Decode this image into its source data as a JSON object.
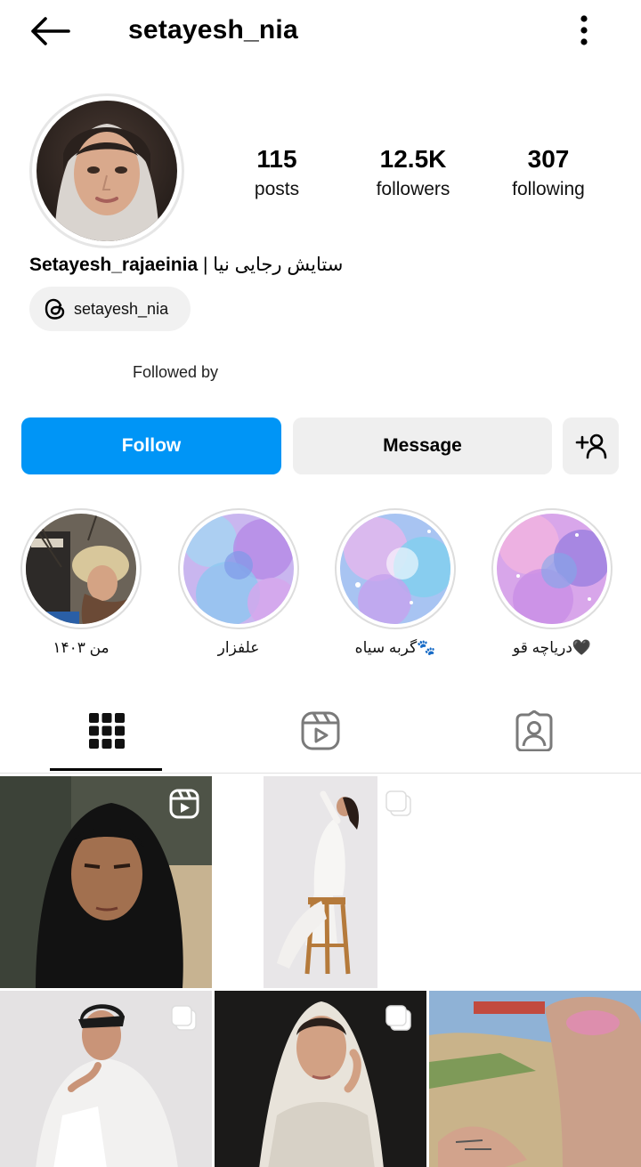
{
  "header": {
    "username": "setayesh_nia"
  },
  "profile": {
    "stats": [
      {
        "count": "115",
        "label": "posts"
      },
      {
        "count": "12.5K",
        "label": "followers"
      },
      {
        "count": "307",
        "label": "following"
      }
    ],
    "fullname_latin": "Setayesh_rajaeinia",
    "fullname_separator": " | ",
    "fullname_persian": "ستایش رجایی نیا",
    "threads_handle": "setayesh_nia",
    "followed_by_label": "Followed by"
  },
  "actions": {
    "follow_label": "Follow",
    "message_label": "Message",
    "add_user_icon": "add-person-icon"
  },
  "highlights": [
    {
      "label": "من ۱۴۰۳"
    },
    {
      "label": "علفزار"
    },
    {
      "label": "گربه سیاه🐾"
    },
    {
      "label": "دریاچه قو🖤"
    }
  ],
  "tabs": [
    {
      "icon": "grid-icon",
      "active": true
    },
    {
      "icon": "reels-icon",
      "active": false
    },
    {
      "icon": "tagged-icon",
      "active": false
    }
  ],
  "posts": [
    {
      "badge": "reel-icon"
    },
    {
      "badge": "carousel-icon"
    },
    {
      "badge": "carousel-icon"
    },
    {
      "badge": "carousel-icon"
    },
    {
      "badge": ""
    }
  ],
  "colors": {
    "accent": "#0095f6",
    "button_grey": "#efefef",
    "chip_grey": "#f1f1f1"
  }
}
